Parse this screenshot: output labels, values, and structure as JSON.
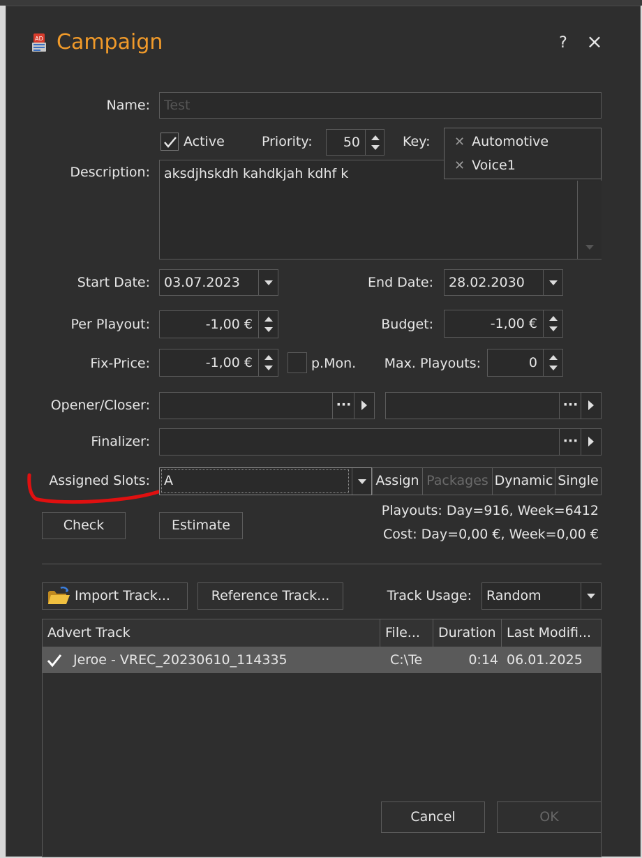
{
  "window": {
    "title": "Campaign",
    "help_label": "?",
    "close_label": "×",
    "app_icon_text": "AD"
  },
  "form": {
    "name_label": "Name:",
    "name_placeholder": "Test",
    "active_label": "Active",
    "active_checked": true,
    "priority_label": "Priority:",
    "priority_value": "50",
    "key_label": "Key:",
    "keys": [
      "Automotive",
      "Voice1"
    ],
    "description_label": "Description:",
    "description_value": "aksdjhskdh kahdkjah kdhf k",
    "start_date_label": "Start Date:",
    "start_date_value": "03.07.2023",
    "end_date_label": "End Date:",
    "end_date_value": "28.02.2030",
    "per_playout_label": "Per Playout:",
    "per_playout_value": "-1,00 €",
    "budget_label": "Budget:",
    "budget_value": "-1,00 €",
    "fix_price_label": "Fix-Price:",
    "fix_price_value": "-1,00 €",
    "pmon_label": "p.Mon.",
    "pmon_checked": false,
    "max_playouts_label": "Max. Playouts:",
    "max_playouts_value": "0",
    "opener_closer_label": "Opener/Closer:",
    "opener_value": "",
    "closer_value": "",
    "finalizer_label": "Finalizer:",
    "finalizer_value": "",
    "ellipsis": "···",
    "assigned_slots_label": "Assigned Slots:",
    "assigned_slots_value": "A",
    "assign_label": "Assign",
    "packages_label": "Packages",
    "dynamic_label": "Dynamic",
    "single_label": "Single",
    "check_label": "Check",
    "estimate_label": "Estimate",
    "playouts_text": "Playouts: Day=916, Week=6412",
    "cost_text": "Cost: Day=0,00 €, Week=0,00 €"
  },
  "tracks": {
    "import_label": "Import Track...",
    "reference_label": "Reference Track...",
    "usage_label": "Track Usage:",
    "usage_value": "Random",
    "columns": [
      "Advert Track",
      "File...",
      "Duration",
      "Last Modifi..."
    ],
    "rows": [
      {
        "checked": true,
        "track": "Jeroe - VREC_20230610_114335",
        "file": "C:\\Te",
        "duration": "0:14",
        "modified": "06.01.2025"
      }
    ]
  },
  "footer": {
    "cancel_label": "Cancel",
    "ok_label": "OK"
  },
  "colors": {
    "title": "#f09a2a",
    "background": "#2e2e2e",
    "annotation": "#e01010",
    "selected_row": "#5a5a5a"
  }
}
